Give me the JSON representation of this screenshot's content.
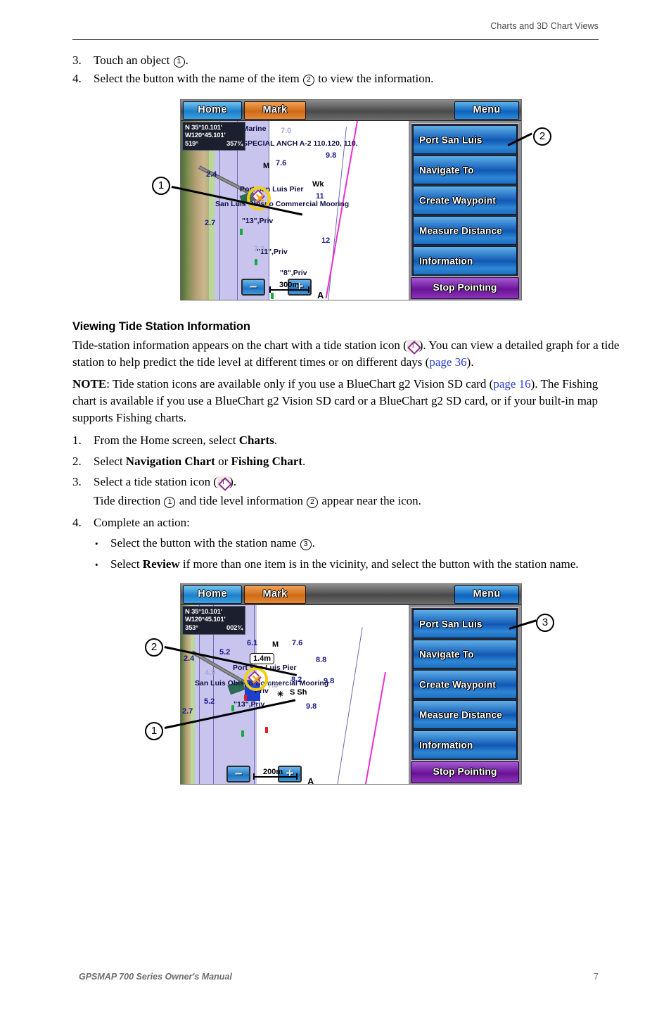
{
  "header": {
    "title": "Charts and 3D Chart Views"
  },
  "footer": {
    "manual": "GPSMAP 700 Series Owner's Manual",
    "page_number": "7"
  },
  "top_steps": [
    {
      "num": "3.",
      "pre": "Touch an object ",
      "callout": "1",
      "post": "."
    },
    {
      "num": "4.",
      "pre": "Select the button with the name of the item ",
      "callout": "2",
      "post": " to view the information."
    }
  ],
  "section": {
    "title": "Viewing Tide Station Information",
    "intro_a": "Tide-station information appears on the chart with a tide station icon (",
    "intro_b": "). You can view a detailed graph for a tide station to help predict the tide level at different times or on different days (",
    "intro_link": "page 36",
    "intro_c": ").",
    "note_label": "NOTE",
    "note_a": ": Tide station icons are available only if you use a BlueChart g2 Vision SD card (",
    "note_link": "page 16",
    "note_b": "). The Fishing chart is available if you use a BlueChart g2 Vision SD card or a BlueChart g2 SD card, or if your built-in map supports Fishing charts."
  },
  "procedure": {
    "step1_num": "1.",
    "step1_a": "From the Home screen, select ",
    "step1_bold": "Charts",
    "step1_b": ".",
    "step2_num": "2.",
    "step2_a": "Select ",
    "step2_bold1": "Navigation Chart",
    "step2_mid": " or ",
    "step2_bold2": "Fishing Chart",
    "step2_b": ".",
    "step3_num": "3.",
    "step3_a": "Select a tide station icon (",
    "step3_b": ").",
    "step3_sub_a": "Tide direction ",
    "step3_sub_c1": "1",
    "step3_sub_b": " and tide level information ",
    "step3_sub_c2": "2",
    "step3_sub_c": " appear near the icon.",
    "step4_num": "4.",
    "step4_text": "Complete an action:",
    "bullet1_a": "Select the button with the station name ",
    "bullet1_c": "3",
    "bullet1_b": ".",
    "bullet2_a": "Select ",
    "bullet2_bold": "Review",
    "bullet2_b": " if more than one item is in the vicinity, and select the button with the station name."
  },
  "device_screen_1": {
    "topbar": {
      "home": "Home",
      "mark": "Mark",
      "menu": "Menu"
    },
    "coords": {
      "lat": "N 35°10.101'",
      "lon": "W120°45.101'",
      "heading": "519°",
      "speed": "357¾"
    },
    "menu_buttons": [
      "Port San Luis",
      "Navigate To",
      "Create Waypoint",
      "Measure Distance",
      "Information"
    ],
    "stop_button": "Stop Pointing",
    "map": {
      "scale": "300m",
      "north_label": "A",
      "zoom_out": "–",
      "zoom_in": "+",
      "labels": [
        "rt Side Marine",
        "SPECIAL ANCH A-2 110.120, 110.",
        "Port San Luis Pier",
        "San Luis Obispo Commercial Mooring",
        "\"13\",Priv",
        "\"11\",Priv",
        "\"8\",Priv"
      ],
      "symbols": [
        "S",
        "M",
        "Wk"
      ],
      "depths": [
        "9.8",
        "7.6",
        "11",
        "12",
        "2.4",
        "2.7",
        "7.0",
        "7.3"
      ]
    }
  },
  "device_screen_2": {
    "topbar": {
      "home": "Home",
      "mark": "Mark",
      "menu": "Menu"
    },
    "coords": {
      "lat": "N 35°10.101'",
      "lon": "W120°45.101'",
      "heading": "353°",
      "speed": "002¾"
    },
    "menu_buttons": [
      "Port San Luis",
      "Navigate To",
      "Create Waypoint",
      "Measure Distance",
      "Information"
    ],
    "stop_button": "Stop Pointing",
    "map": {
      "scale": "200m",
      "north_label": "A",
      "zoom_out": "–",
      "zoom_in": "+",
      "tide_level": "1.4m",
      "labels": [
        "Port San Luis Pier",
        "San Luis Obispo Commercial Mooring",
        "\"13\",Priv",
        "Priv"
      ],
      "symbols": [
        "M",
        "S Sh"
      ],
      "depths": [
        "6.1",
        "7.6",
        "8.8",
        "8.2",
        "9.8",
        "5.2",
        "2.4",
        "2.7",
        "4.9",
        "7.3"
      ]
    }
  },
  "callouts": {
    "fig1_one": "1",
    "fig1_two": "2",
    "fig2_one": "1",
    "fig2_two": "2",
    "fig2_three": "3"
  }
}
